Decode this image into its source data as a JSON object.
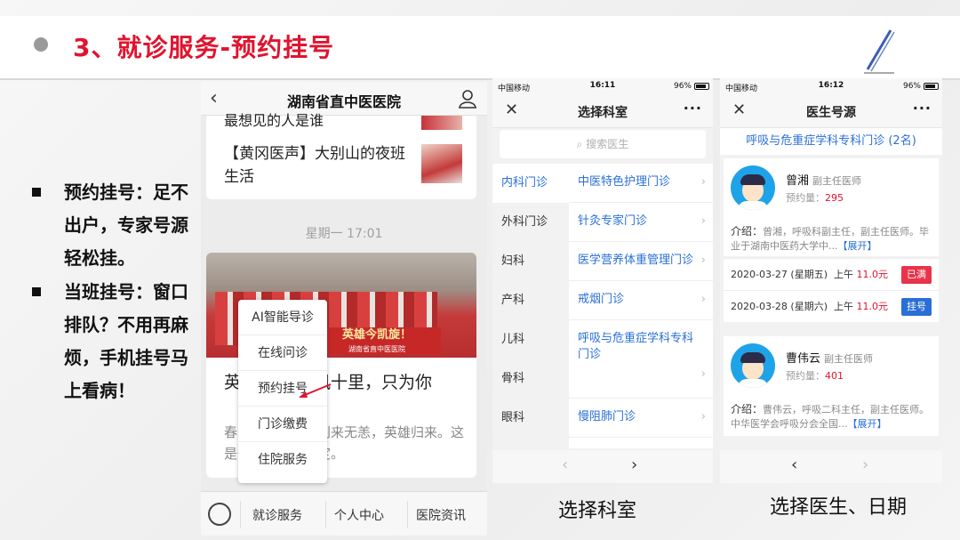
{
  "slide": {
    "title": "3、就诊服务-预约挂号",
    "bullets": [
      "预约挂号：足不出户，专家号源轻松挂。",
      "当班挂号：窗口排队？不用再麻烦，手机挂号马上看病！"
    ]
  },
  "phone1": {
    "title": "湖南省直中医医院",
    "news": [
      "最想见的人是谁",
      "【黄冈医声】大别山的夜班生活"
    ],
    "timestamp": "星期一 17:01",
    "banner_main": "英雄今凯旋！",
    "banner_sub": "湖南省直中医医院",
    "article_title": "英雄凯旋 春风十里，只为你",
    "article_body": "春暖花开，我们别来无恙，英雄归来。这是一场最美的约定。",
    "menu": [
      "AI智能导诊",
      "在线问诊",
      "预约挂号",
      "门诊缴费",
      "住院服务"
    ],
    "tabs": [
      "就诊服务",
      "个人中心",
      "医院资讯"
    ]
  },
  "phone2": {
    "carrier": "中国移动",
    "time": "16:11",
    "battery": "96%",
    "title": "选择科室",
    "search_placeholder": "搜索医生",
    "departments": [
      "内科门诊",
      "外科门诊",
      "妇科",
      "产科",
      "儿科",
      "骨科",
      "眼科"
    ],
    "clinics": [
      "中医特色护理门诊",
      "针灸专家门诊",
      "医学营养体重管理门诊",
      "戒烟门诊",
      "呼吸与危重症学科专科门诊",
      "慢阻肺门诊"
    ],
    "caption": "选择科室"
  },
  "phone3": {
    "carrier": "中国移动",
    "time": "16:12",
    "battery": "96%",
    "title": "医生号源",
    "dept_header": "呼吸与危重症学科专科门诊 (2名)",
    "doctors": [
      {
        "name": "曾湘",
        "rank": "副主任医师",
        "count_label": "预约量：",
        "count": "295",
        "intro_label": "介绍：",
        "intro": "曾湘，呼吸科副主任，副主任医师。毕业于湖南中医药大学中...",
        "more": "【展开】"
      },
      {
        "name": "曹伟云",
        "rank": "副主任医师",
        "count_label": "预约量：",
        "count": "401",
        "intro_label": "介绍：",
        "intro": "曹伟云，呼吸二科主任，副主任医师。中华医学会呼吸分会全国...",
        "more": "【展开】"
      }
    ],
    "schedules": [
      {
        "date": "2020-03-27 (星期五)",
        "period": "上午",
        "price": "11.0元",
        "status": "已满",
        "status_color": "#e8334a"
      },
      {
        "date": "2020-03-28 (星期六)",
        "period": "上午",
        "price": "11.0元",
        "status": "挂号",
        "status_color": "#2a6fd6"
      }
    ],
    "caption": "选择医生、日期"
  }
}
